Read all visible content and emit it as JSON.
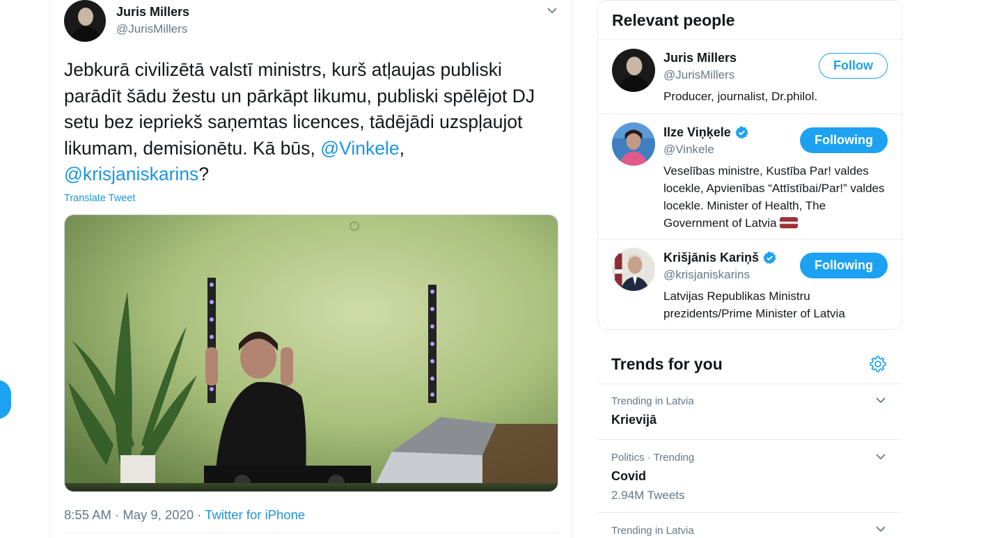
{
  "tweet": {
    "author_name": "Juris Millers",
    "author_handle": "@JurisMillers",
    "text_part1": "Jebkurā civilizētā valstī ministrs, kurš atļaujas publiski parādīt šādu žestu un pārkāpt likumu, publiski spēlējot DJ setu bez iepriekš saņemtas licences, tādējādi uzspļaujot likumam, demisionētu. Kā būs, ",
    "mention1": "@Vinkele",
    "text_part2": ", ",
    "mention2": "@krisjaniskarins",
    "text_part3": "?",
    "translate_label": "Translate Tweet",
    "time": "8:55 AM · May 9, 2020 · ",
    "source": "Twitter for iPhone"
  },
  "relevant_people": {
    "title": "Relevant people",
    "people": [
      {
        "name": "Juris Millers",
        "handle": "@JurisMillers",
        "bio": "Producer, journalist, Dr.philol.",
        "button": "Follow",
        "verified": false
      },
      {
        "name": "Ilze Viņķele",
        "handle": "@Vinkele",
        "bio": "Veselības ministre, Kustība Par! valdes locekle, Apvienības “Attīstībai/Par!” valdes locekle. Minister of Health, The Government of Latvia",
        "button": "Following",
        "verified": true
      },
      {
        "name": "Krišjānis Kariņš",
        "handle": "@krisjaniskarins",
        "bio": "Latvijas Republikas Ministru prezidents/Prime Minister of Latvia",
        "button": "Following",
        "verified": true
      }
    ]
  },
  "trends": {
    "title": "Trends for you",
    "items": [
      {
        "meta": "Trending in Latvia",
        "name": "Krievijā",
        "count": ""
      },
      {
        "meta": "Politics · Trending",
        "name": "Covid",
        "count": "2.94M Tweets"
      },
      {
        "meta": "Trending in Latvia",
        "name": "",
        "count": ""
      }
    ]
  },
  "colors": {
    "accent": "#1da1f2",
    "link": "#1b95e0",
    "secondary_text": "#657786"
  }
}
